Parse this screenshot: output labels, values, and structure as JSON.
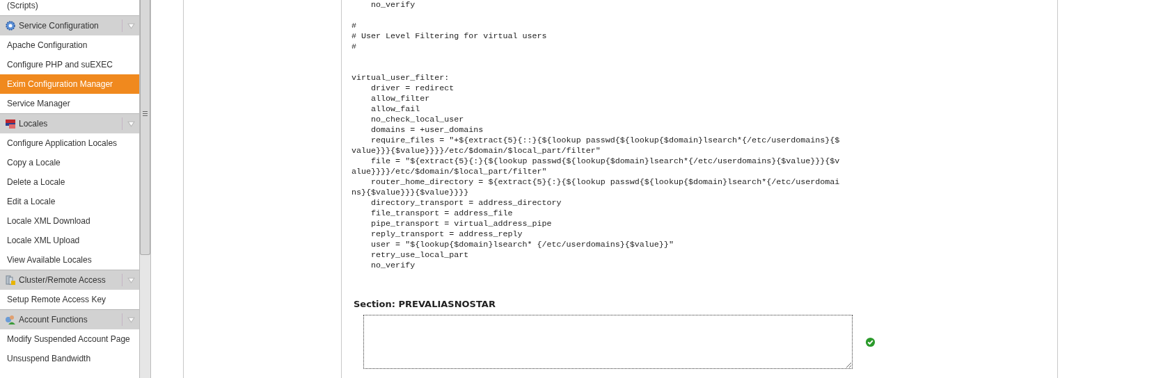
{
  "sidebar": {
    "items": [
      {
        "kind": "link",
        "label": "(Scripts)",
        "selected": false
      },
      {
        "kind": "header",
        "label": "Service Configuration"
      },
      {
        "kind": "link",
        "label": "Apache Configuration",
        "selected": false
      },
      {
        "kind": "link",
        "label": "Configure PHP and suEXEC",
        "selected": false
      },
      {
        "kind": "link",
        "label": "Exim Configuration Manager",
        "selected": true
      },
      {
        "kind": "link",
        "label": "Service Manager",
        "selected": false
      },
      {
        "kind": "header",
        "label": "Locales"
      },
      {
        "kind": "link",
        "label": "Configure Application Locales",
        "selected": false
      },
      {
        "kind": "link",
        "label": "Copy a Locale",
        "selected": false
      },
      {
        "kind": "link",
        "label": "Delete a Locale",
        "selected": false
      },
      {
        "kind": "link",
        "label": "Edit a Locale",
        "selected": false
      },
      {
        "kind": "link",
        "label": "Locale XML Download",
        "selected": false
      },
      {
        "kind": "link",
        "label": "Locale XML Upload",
        "selected": false
      },
      {
        "kind": "link",
        "label": "View Available Locales",
        "selected": false
      },
      {
        "kind": "header",
        "label": "Cluster/Remote Access"
      },
      {
        "kind": "link",
        "label": "Setup Remote Access Key",
        "selected": false
      },
      {
        "kind": "header",
        "label": "Account Functions"
      },
      {
        "kind": "link",
        "label": "Modify Suspended Account Page",
        "selected": false
      },
      {
        "kind": "link",
        "label": "Unsuspend Bandwidth",
        "selected": false
      }
    ]
  },
  "code": "    no_verify\n\n#\n# User Level Filtering for virtual users\n#\n\n\nvirtual_user_filter:\n    driver = redirect\n    allow_filter\n    allow_fail\n    no_check_local_user\n    domains = +user_domains\n    require_files = \"+${extract{5}{::}{${lookup passwd{${lookup{$domain}lsearch*{/etc/userdomains}{$\nvalue}}}{$value}}}}/etc/$domain/$local_part/filter\"\n    file = \"${extract{5}{:}{${lookup passwd{${lookup{$domain}lsearch*{/etc/userdomains}{$value}}}{$v\nalue}}}}/etc/$domain/$local_part/filter\"\n    router_home_directory = ${extract{5}{:}{${lookup passwd{${lookup{$domain}lsearch*{/etc/userdomai\nns}{$value}}}{$value}}}}\n    directory_transport = address_directory\n    file_transport = address_file\n    pipe_transport = virtual_address_pipe\n    reply_transport = address_reply\n    user = \"${lookup{$domain}lsearch* {/etc/userdomains}{$value}}\"\n    retry_use_local_part\n    no_verify",
  "section": {
    "title": "Section: PREVALIASNOSTAR",
    "valid": true
  }
}
